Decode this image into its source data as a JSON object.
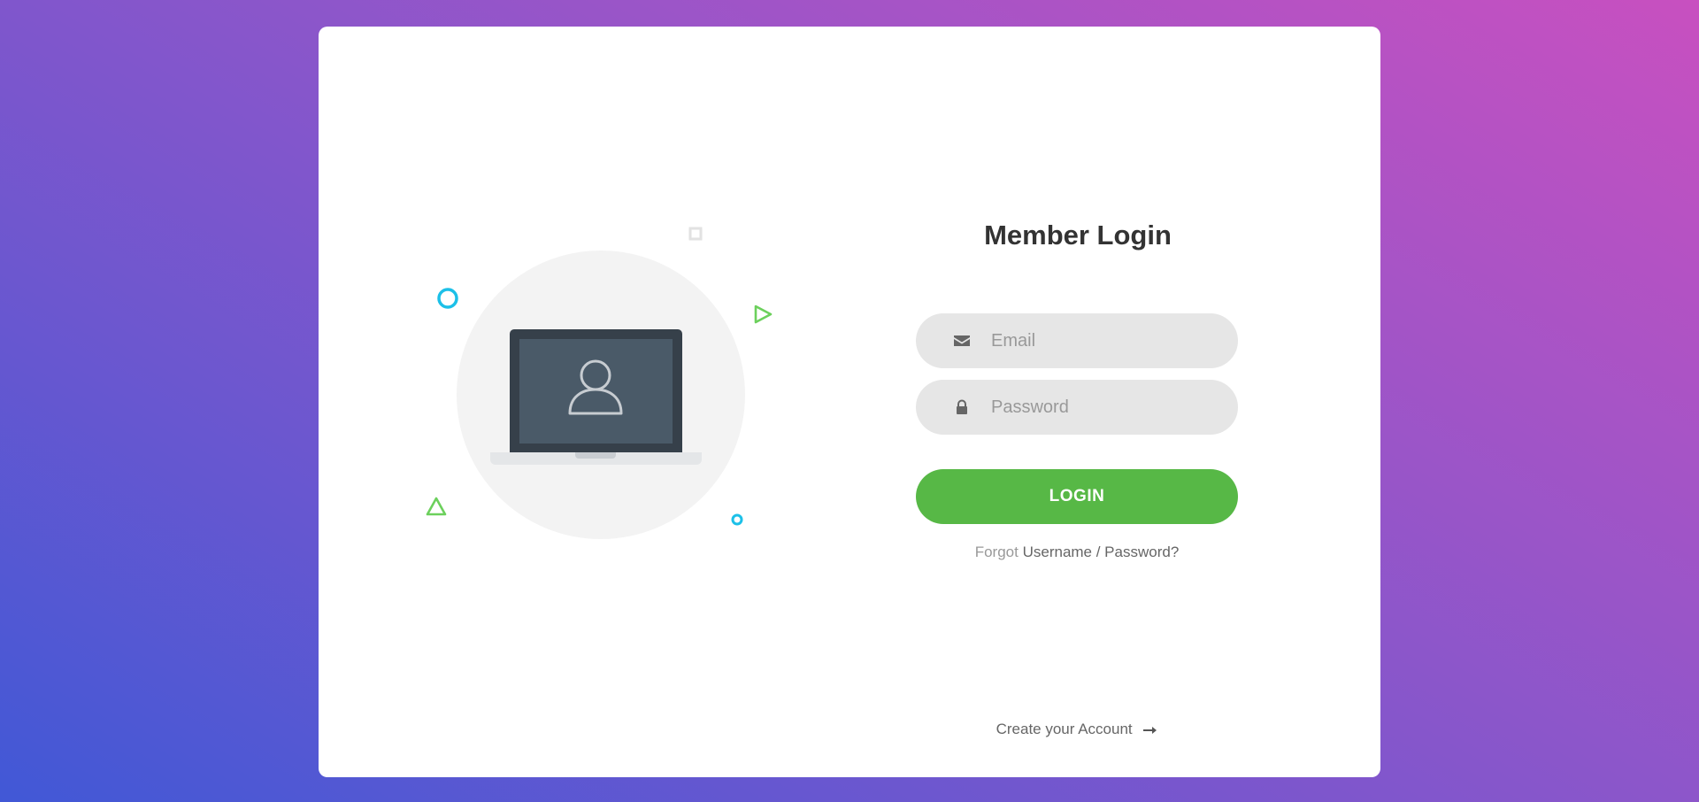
{
  "login": {
    "title": "Member Login",
    "email_placeholder": "Email",
    "password_placeholder": "Password",
    "login_button": "LOGIN",
    "forgot_prefix": "Forgot",
    "forgot_link": "Username / Password?",
    "create_account": "Create your Account"
  },
  "icons": {
    "email": "envelope-icon",
    "password": "lock-icon",
    "create_arrow": "arrow-right-icon",
    "illustration": "laptop-user-icon"
  },
  "colors": {
    "accent": "#57b846",
    "bg_gradient_start": "#4158d6",
    "bg_gradient_end": "#c850c0",
    "deco_blue": "#1cc0e8",
    "deco_green": "#6cd05c"
  }
}
